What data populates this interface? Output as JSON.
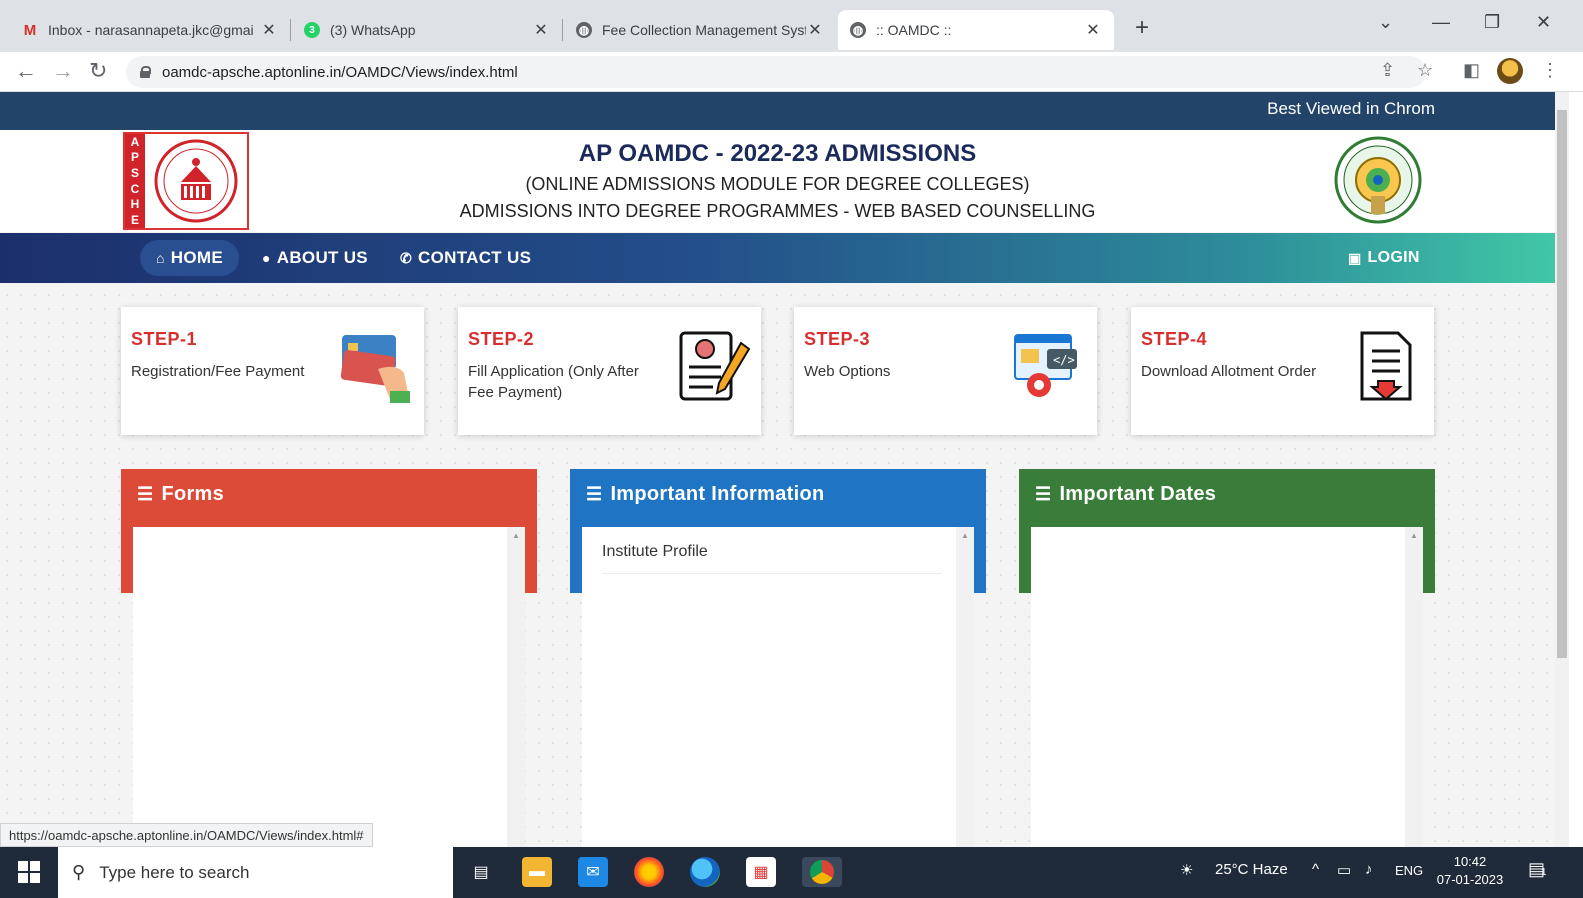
{
  "browser": {
    "tabs": [
      {
        "title": "Inbox - narasannapeta.jkc@gmai",
        "icon": "gmail-icon"
      },
      {
        "title": "(3) WhatsApp",
        "icon": "whatsapp-icon",
        "badge": "3"
      },
      {
        "title": "Fee Collection Management Syst",
        "icon": "globe-icon"
      },
      {
        "title": ":: OAMDC ::",
        "icon": "globe-icon"
      }
    ],
    "url": "oamdc-apsche.aptonline.in/OAMDC/Views/index.html",
    "status_url": "https://oamdc-apsche.aptonline.in/OAMDC/Views/index.html#"
  },
  "page": {
    "best_viewed": "Best Viewed in Chrom",
    "logo_strip": [
      "A",
      "P",
      "S",
      "C",
      "H",
      "E"
    ],
    "title": "AP OAMDC - 2022-23 ADMISSIONS",
    "subtitle1": "(ONLINE ADMISSIONS MODULE FOR DEGREE COLLEGES)",
    "subtitle2": "ADMISSIONS INTO DEGREE PROGRAMMES - WEB BASED COUNSELLING",
    "menu": {
      "home": "HOME",
      "about": "ABOUT US",
      "contact": "CONTACT US",
      "login": "LOGIN"
    },
    "steps": [
      {
        "label": "STEP-1",
        "desc": "Registration/Fee Payment",
        "icon": "credit-card-icon"
      },
      {
        "label": "STEP-2",
        "desc": "Fill Application (Only After Fee Payment)",
        "icon": "application-form-icon"
      },
      {
        "label": "STEP-3",
        "desc": "Web Options",
        "icon": "web-options-icon"
      },
      {
        "label": "STEP-4",
        "desc": "Download Allotment Order",
        "icon": "download-document-icon"
      }
    ],
    "panels": [
      {
        "title": "Forms",
        "color": "#dc4a38",
        "items": []
      },
      {
        "title": "Important Information",
        "color": "#1f75c4",
        "items": [
          "Institute Profile"
        ]
      },
      {
        "title": "Important Dates",
        "color": "#3a7d3a",
        "items": []
      }
    ]
  },
  "taskbar": {
    "search_placeholder": "Type here to search",
    "weather": "25°C Haze",
    "lang": "ENG",
    "time": "10:42",
    "date": "07-01-2023",
    "notification_count": "1"
  }
}
